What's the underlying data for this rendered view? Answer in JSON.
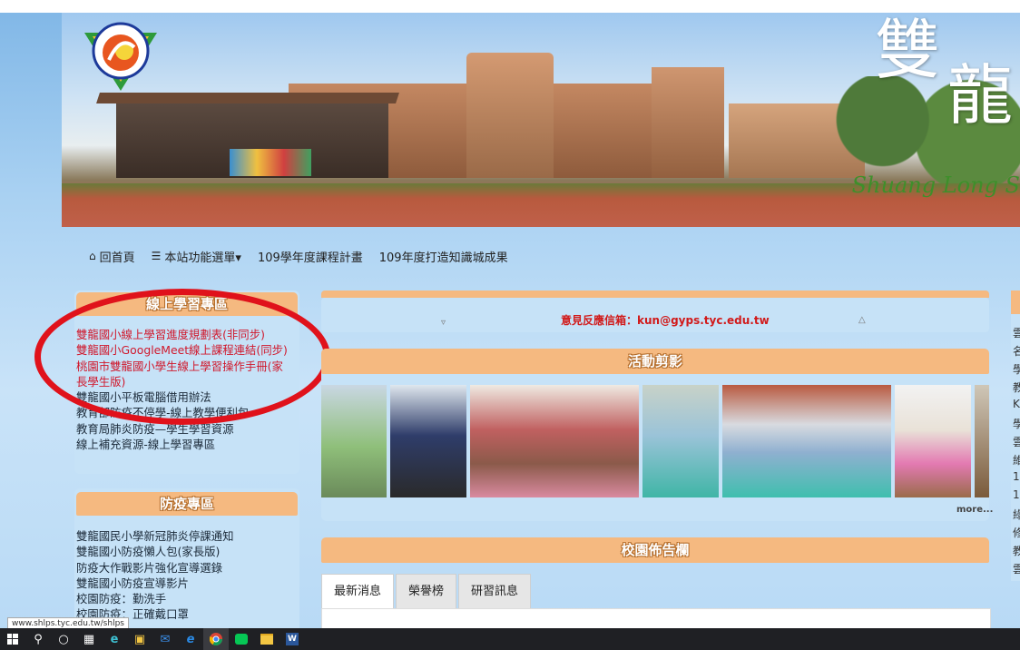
{
  "browser": {
    "status_url": "www.shlps.tyc.edu.tw/shlps"
  },
  "banner": {
    "big_chars": [
      "雙",
      "龍"
    ],
    "slogan": "Shuang Long S",
    "logo_ring_text": "雙龍國民小學"
  },
  "nav": {
    "items": [
      {
        "icon": "home-icon",
        "label": "回首頁"
      },
      {
        "icon": "list-icon",
        "label": "本站功能選單▾"
      },
      {
        "label": "109學年度課程計畫"
      },
      {
        "label": "109年度打造知識城成果"
      }
    ]
  },
  "online_learning": {
    "title": "線上學習專區",
    "links_highlighted": [
      "雙龍國小線上學習進度規劃表(非同步)",
      "雙龍國小GoogleMeet線上課程連結(同步)",
      "桃園市雙龍國小學生線上學習操作手冊(家",
      "長學生版)"
    ],
    "links": [
      "雙龍國小平板電腦借用辦法",
      "教育部防疫不停學-線上教學便利包",
      "教育局肺炎防疫—學生學習資源",
      "線上補充資源-線上學習專區"
    ]
  },
  "epidemic": {
    "title": "防疫專區",
    "links": [
      "雙龍國民小學新冠肺炎停課通知",
      "雙龍國小防疫懶人包(家長版)",
      "防疫大作戰影片強化宣導選錄",
      "雙龍國小防疫宣導影片",
      "校園防疫：勤洗手",
      "校園防疫：正確戴口罩"
    ]
  },
  "feedback": {
    "text": "意見反應信箱：kun@gyps.tyc.edu.tw"
  },
  "gallery": {
    "title": "活動剪影",
    "more": "more..."
  },
  "bulletin": {
    "title": "校園佈告欄",
    "tabs": [
      "最新消息",
      "榮譽榜",
      "研習訊息"
    ]
  },
  "right_column": {
    "chars": [
      "雲",
      "名",
      "學",
      "教",
      "K",
      "學",
      "雲",
      "維",
      "1",
      "1",
      "綠",
      "修",
      "教",
      "雲"
    ]
  },
  "colors": {
    "header_orange": "#f5b980",
    "panel_blue": "#c6e2f7",
    "highlight_red": "#e0121b",
    "link_red": "#d0182c"
  },
  "taskbar": {
    "icons": [
      "windows-start-icon",
      "search-icon",
      "cortana-icon",
      "task-view-icon",
      "edge-icon",
      "store-icon",
      "mail-icon",
      "ie-icon",
      "chrome-icon",
      "line-icon",
      "file-explorer-icon",
      "word-icon"
    ]
  }
}
